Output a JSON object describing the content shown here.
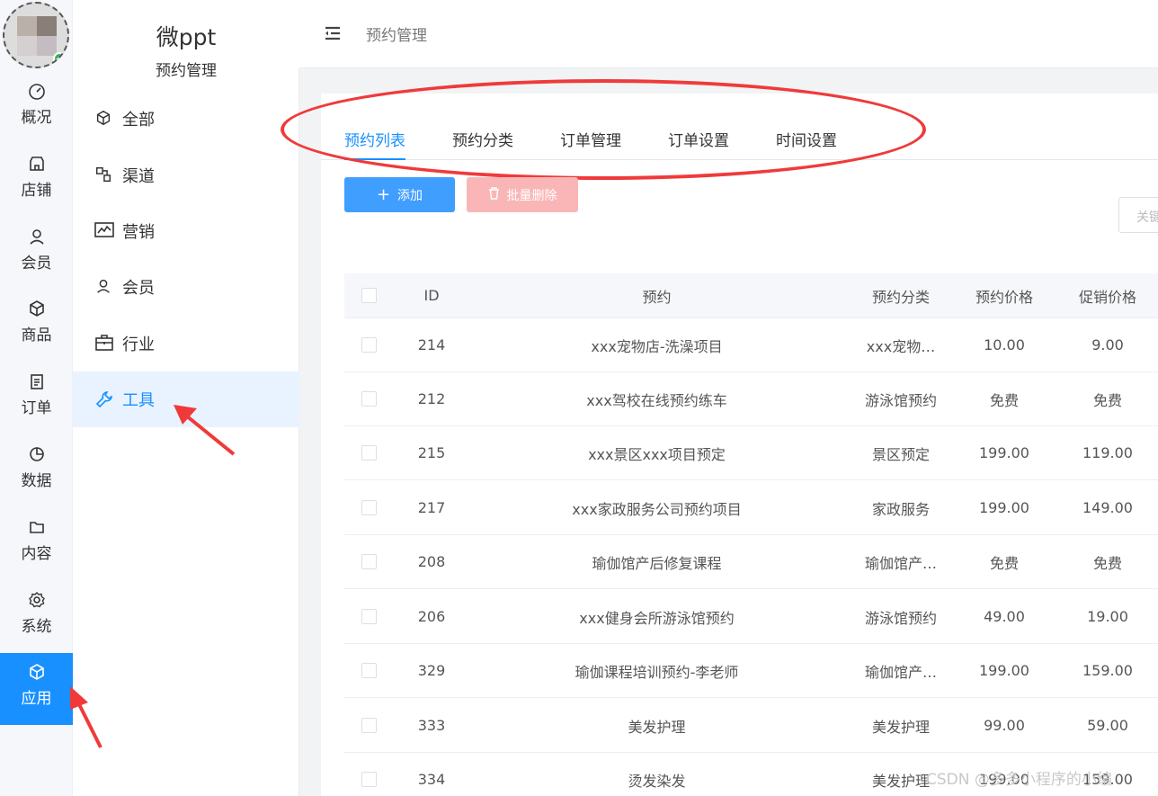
{
  "colors": {
    "accent": "#1890ff",
    "annotation": "#f03a3a",
    "add_button": "#409eff",
    "delete_button": "#fab6b6"
  },
  "rail": {
    "items": [
      {
        "label": "概况",
        "icon": "dashboard-icon"
      },
      {
        "label": "店铺",
        "icon": "store-icon"
      },
      {
        "label": "会员",
        "icon": "user-icon"
      },
      {
        "label": "商品",
        "icon": "box-icon"
      },
      {
        "label": "订单",
        "icon": "clipboard-icon"
      },
      {
        "label": "数据",
        "icon": "pie-chart-icon"
      },
      {
        "label": "内容",
        "icon": "folder-icon"
      },
      {
        "label": "系统",
        "icon": "gear-icon"
      },
      {
        "label": "应用",
        "icon": "cube-icon"
      }
    ],
    "active": "应用"
  },
  "brand": {
    "title": "微ppt",
    "subtitle": "预约管理"
  },
  "submenu": {
    "items": [
      {
        "label": "全部",
        "icon": "cube-icon"
      },
      {
        "label": "渠道",
        "icon": "channel-icon"
      },
      {
        "label": "营销",
        "icon": "trend-icon"
      },
      {
        "label": "会员",
        "icon": "user-icon"
      },
      {
        "label": "行业",
        "icon": "briefcase-icon"
      },
      {
        "label": "工具",
        "icon": "wrench-icon"
      }
    ],
    "active": "工具"
  },
  "topbar": {
    "breadcrumb": "预约管理"
  },
  "tabs": [
    {
      "label": "预约列表",
      "active": true
    },
    {
      "label": "预约分类",
      "active": false
    },
    {
      "label": "订单管理",
      "active": false
    },
    {
      "label": "订单设置",
      "active": false
    },
    {
      "label": "时间设置",
      "active": false
    }
  ],
  "toolbar": {
    "add_label": "添加",
    "batch_delete_label": "批量删除",
    "search_placeholder": "关键"
  },
  "table": {
    "columns": [
      "ID",
      "预约",
      "预约分类",
      "预约价格",
      "促销价格"
    ],
    "rows": [
      {
        "id": "214",
        "name": "xxx宠物店-洗澡项目",
        "category": "xxx宠物…",
        "price": "10.00",
        "promo": "9.00"
      },
      {
        "id": "212",
        "name": "xxx驾校在线预约练车",
        "category": "游泳馆预约",
        "price": "免费",
        "promo": "免费"
      },
      {
        "id": "215",
        "name": "xxx景区xxx项目预定",
        "category": "景区预定",
        "price": "199.00",
        "promo": "119.00"
      },
      {
        "id": "217",
        "name": "xxx家政服务公司预约项目",
        "category": "家政服务",
        "price": "199.00",
        "promo": "149.00"
      },
      {
        "id": "208",
        "name": "瑜伽馆产后修复课程",
        "category": "瑜伽馆产…",
        "price": "免费",
        "promo": "免费"
      },
      {
        "id": "206",
        "name": "xxx健身会所游泳馆预约",
        "category": "游泳馆预约",
        "price": "49.00",
        "promo": "19.00"
      },
      {
        "id": "329",
        "name": "瑜伽课程培训预约-李老师",
        "category": "瑜伽馆产…",
        "price": "199.00",
        "promo": "159.00"
      },
      {
        "id": "333",
        "name": "美发护理",
        "category": "美发护理",
        "price": "99.00",
        "promo": "59.00"
      },
      {
        "id": "334",
        "name": "烫发染发",
        "category": "美发护理",
        "price": "199.00",
        "promo": "159.00"
      }
    ]
  },
  "watermark": "CSDN @多多小程序的小编"
}
